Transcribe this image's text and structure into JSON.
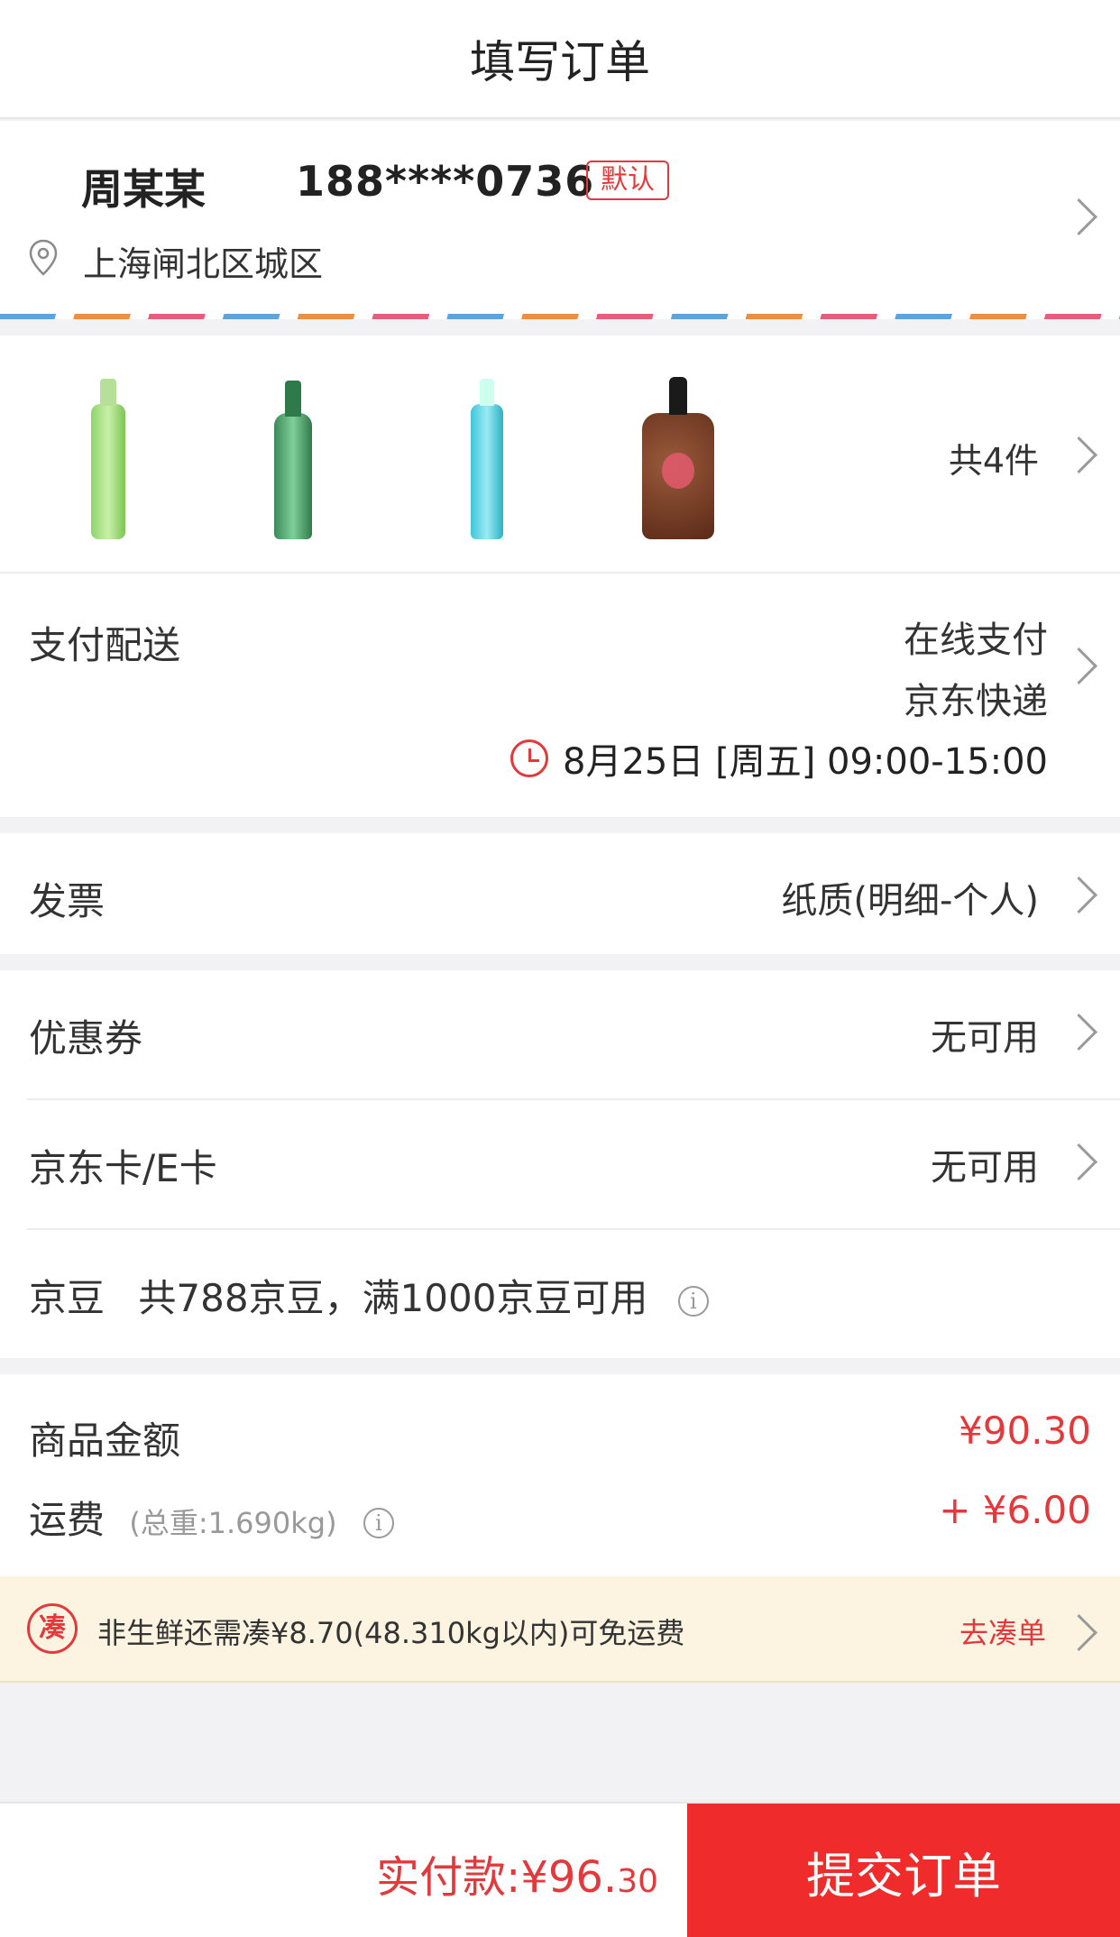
{
  "header": {
    "title": "填写订单"
  },
  "address": {
    "name": "周某某",
    "phone": "188****0736",
    "badge": "默认",
    "location": "上海闸北区城区"
  },
  "products": {
    "count_label": "共4件",
    "items": [
      {
        "icon": "green-spray-bottle"
      },
      {
        "icon": "green-glass-bottle"
      },
      {
        "icon": "blue-spray-bottle"
      },
      {
        "icon": "brown-pump-bottle"
      }
    ]
  },
  "payment": {
    "label": "支付配送",
    "method": "在线支付",
    "delivery": "京东快递",
    "time": "8月25日 [周五] 09:00-15:00"
  },
  "invoice": {
    "label": "发票",
    "value": "纸质(明细-个人)"
  },
  "coupon": {
    "label": "优惠券",
    "value": "无可用"
  },
  "jdcard": {
    "label": "京东卡/E卡",
    "value": "无可用"
  },
  "jingdou": {
    "label": "京豆",
    "text": "共788京豆，满1000京豆可用"
  },
  "summary": {
    "goods_label": "商品金额",
    "goods_amount": "¥90.30",
    "freight_label": "运费",
    "freight_weight": "(总重:1.690kg)",
    "freight_amount": "+ ¥6.00"
  },
  "notice": {
    "icon_text": "凑",
    "message": "非生鲜还需凑¥8.70(48.310kg以内)可免运费",
    "link": "去凑单"
  },
  "footer": {
    "total_label": "实付款:",
    "total_main": "¥96.",
    "total_cents": "30",
    "submit": "提交订单"
  },
  "colors": {
    "accent": "#e4393c",
    "submit_bg": "#f02b2b",
    "notice_bg": "#fdf3e1"
  }
}
